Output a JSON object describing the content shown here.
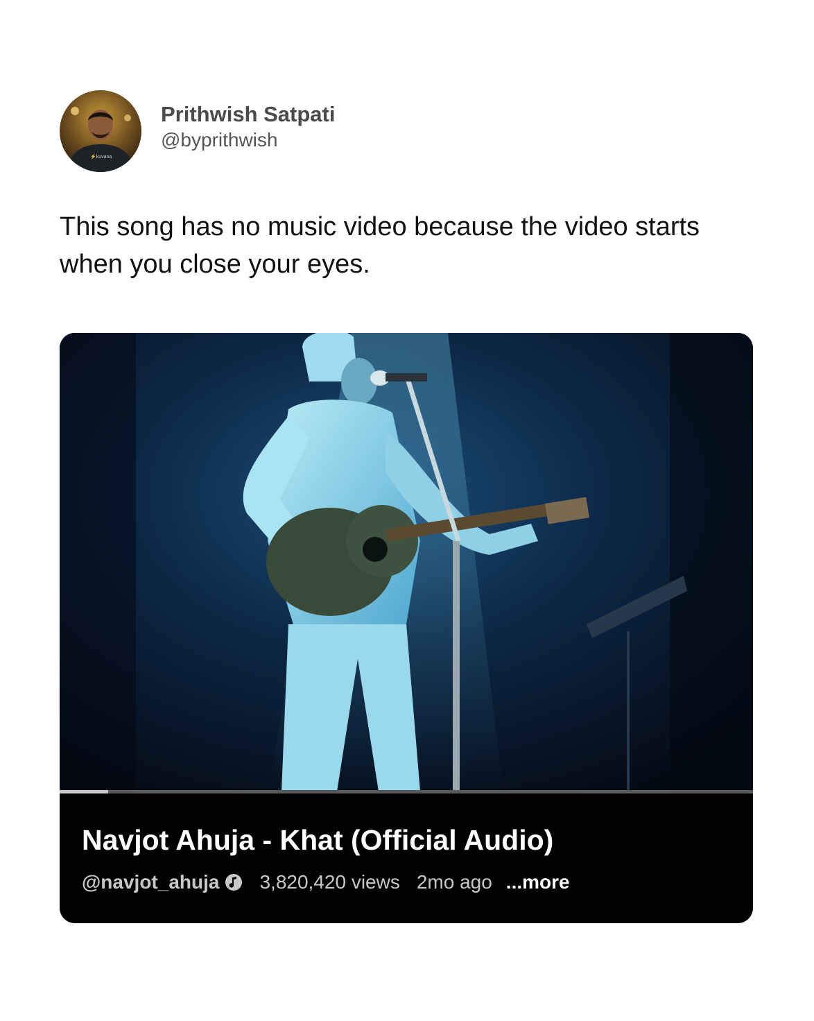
{
  "tweet": {
    "author_name": "Prithwish Satpati",
    "author_handle": "@byprithwish",
    "text": "This song has no music video because the video starts when you close your eyes."
  },
  "video": {
    "title": "Navjot Ahuja - Khat (Official Audio)",
    "channel": "@navjot_ahuja",
    "views": "3,820,420 views",
    "age": "2mo ago",
    "more_label": "...more",
    "progress_fraction": 0.07
  },
  "icons": {
    "avatar": "avatar-photo",
    "channel_badge": "music-note-icon"
  },
  "colors": {
    "background": "#ffffff",
    "card_background": "#000000",
    "stage_blue": "#0b2a4a"
  }
}
